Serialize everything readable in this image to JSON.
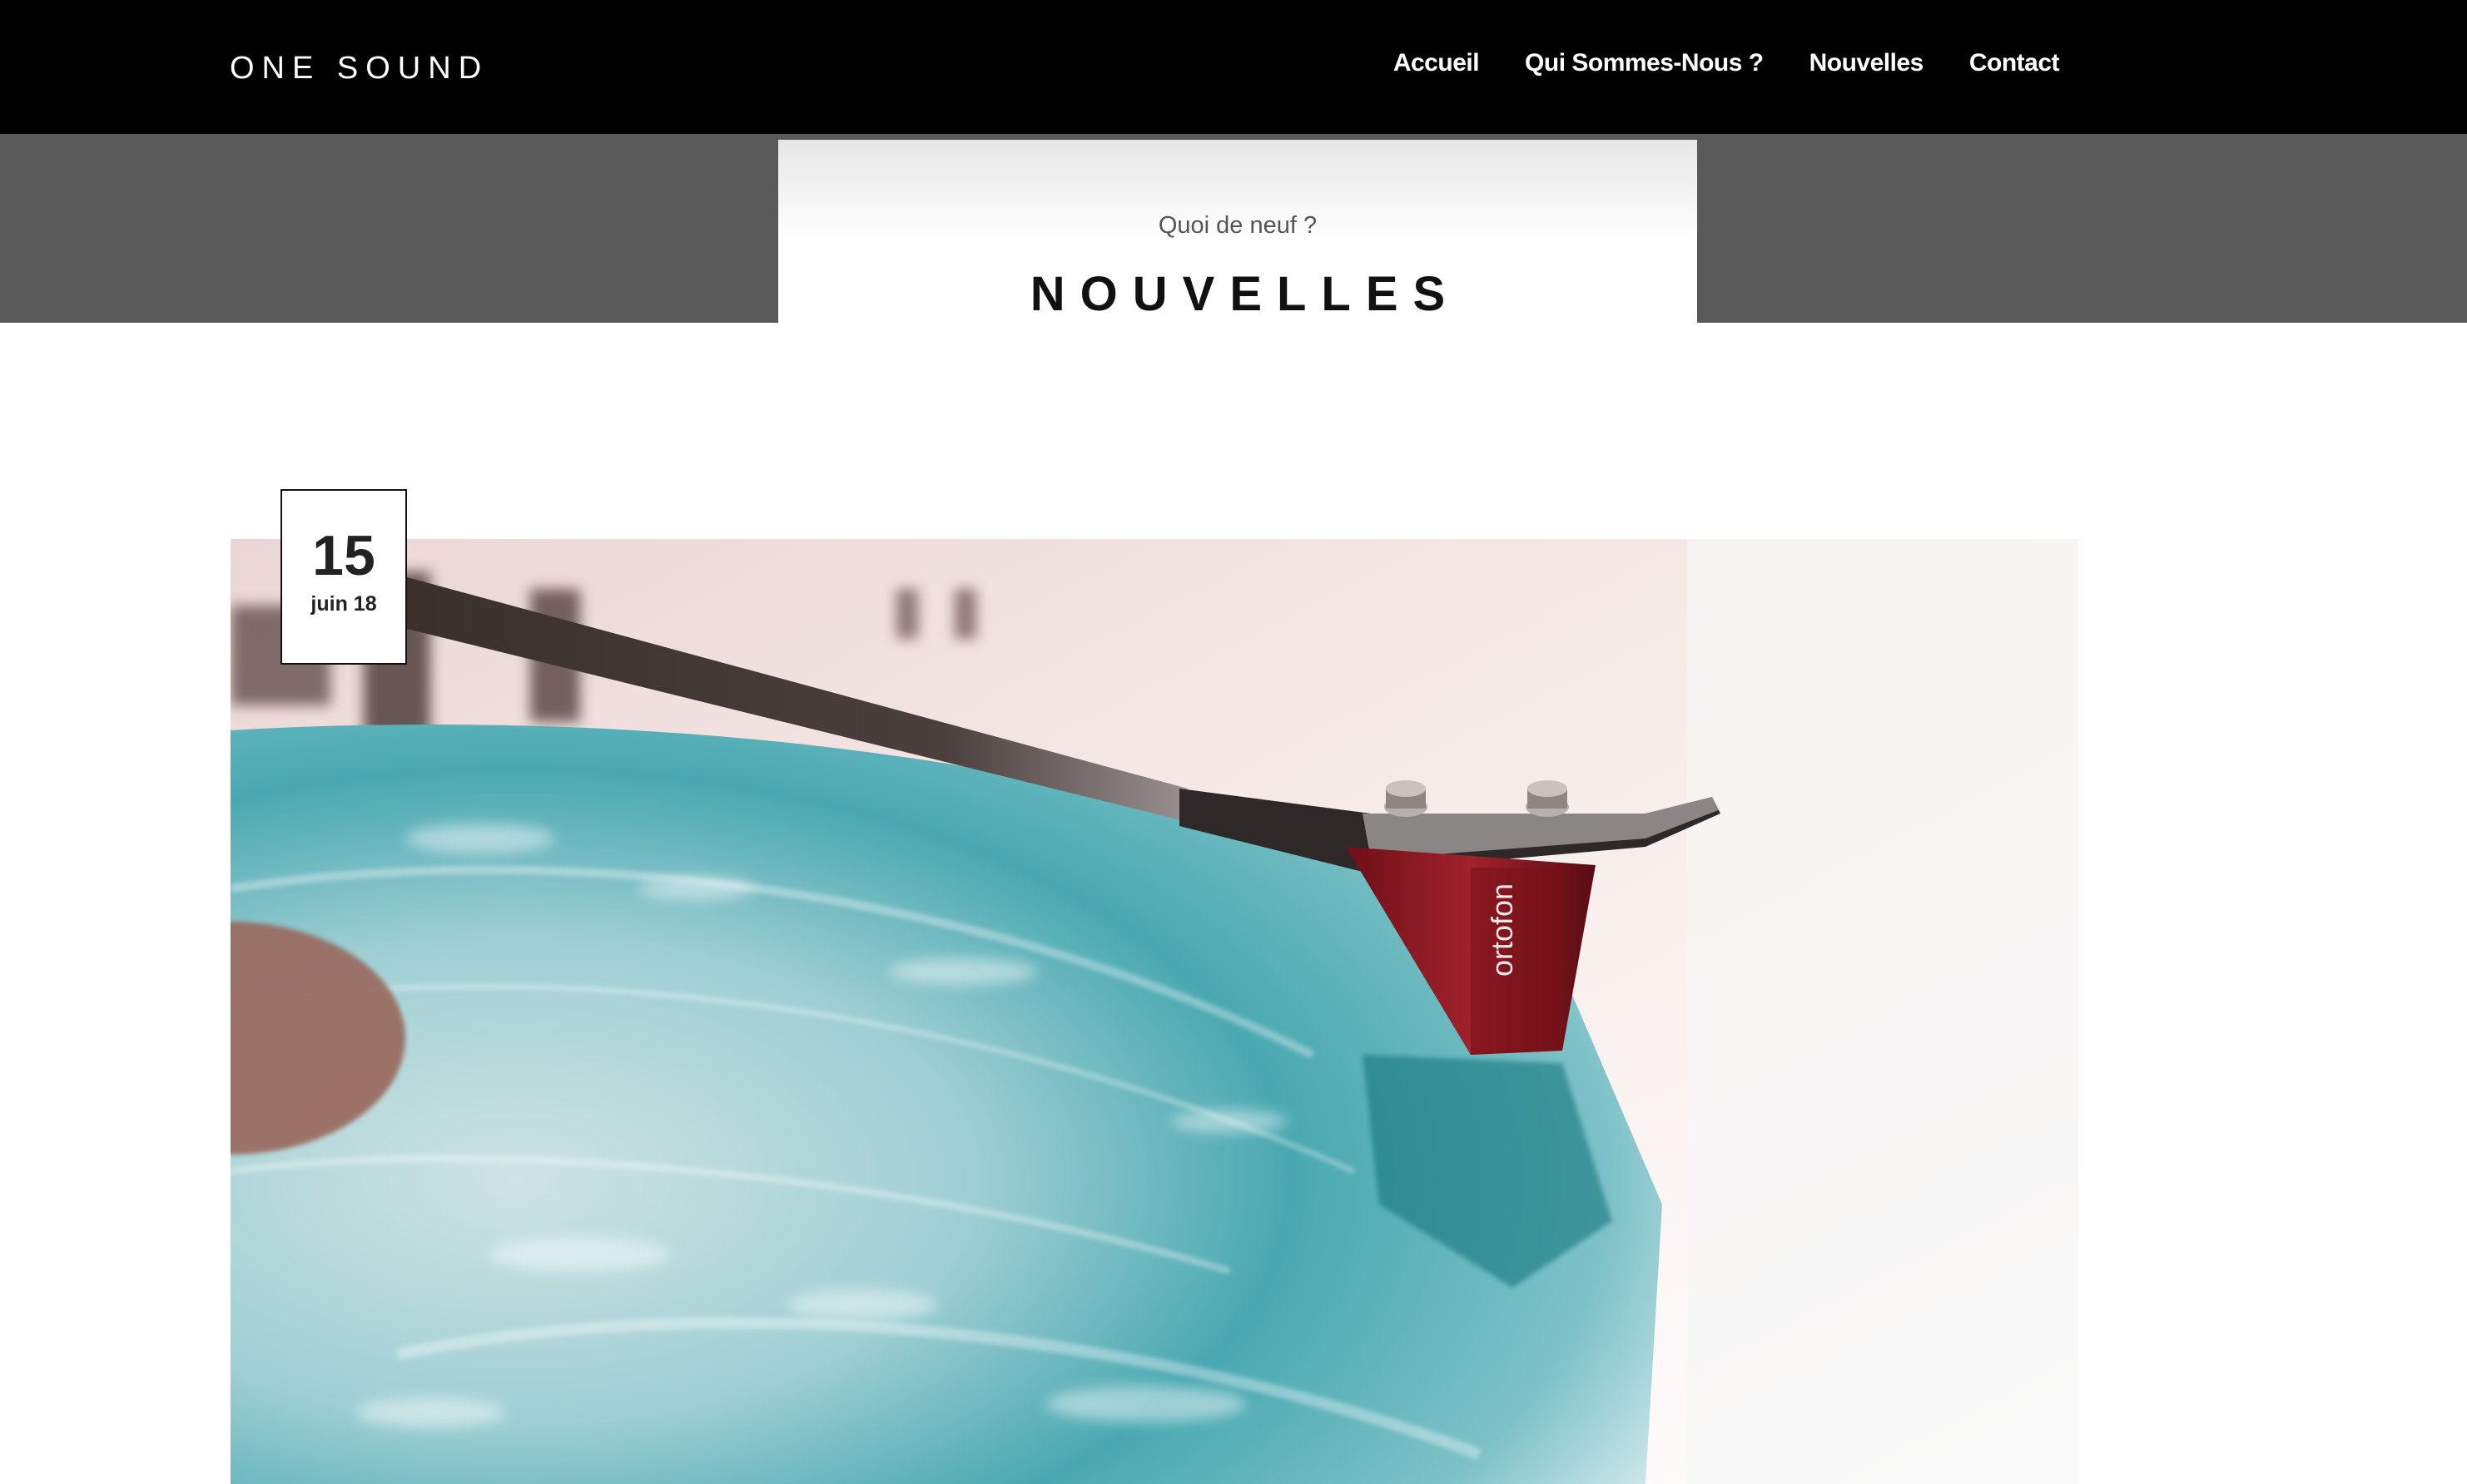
{
  "header": {
    "logo": "ONE SOUND",
    "nav": [
      {
        "label": "Accueil"
      },
      {
        "label": "Qui Sommes-Nous ?"
      },
      {
        "label": "Nouvelles"
      },
      {
        "label": "Contact"
      }
    ]
  },
  "hero": {
    "subtitle": "Quoi de neuf ?",
    "title": "NOUVELLES"
  },
  "post": {
    "date_day": "15",
    "date_month": "juin 18",
    "image_brand_text": "ortofon"
  },
  "colors": {
    "navbar": "#000000",
    "band": "#595959",
    "record": "#3fa9b3",
    "label": "#9a6a5e",
    "cartridge": "#8b1a22"
  }
}
